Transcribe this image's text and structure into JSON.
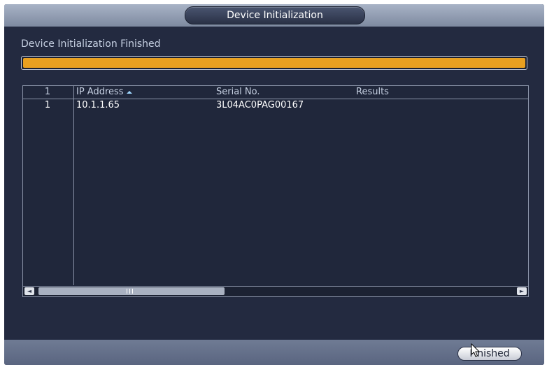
{
  "window": {
    "title": "Device Initialization"
  },
  "status": {
    "label": "Device Initialization Finished",
    "progress_percent": 100
  },
  "table": {
    "headers": {
      "num": "1",
      "ip": "IP Address",
      "serial": "Serial No.",
      "results": "Results"
    },
    "rows": [
      {
        "num": "1",
        "ip": "10.1.1.65",
        "serial": "3L04AC0PAG00167",
        "results": ""
      }
    ],
    "scroll_left_icon": "◄",
    "scroll_right_icon": "►"
  },
  "footer": {
    "finish_label": "Finished"
  },
  "colors": {
    "progress": "#e9a020",
    "background": "#232a40"
  }
}
